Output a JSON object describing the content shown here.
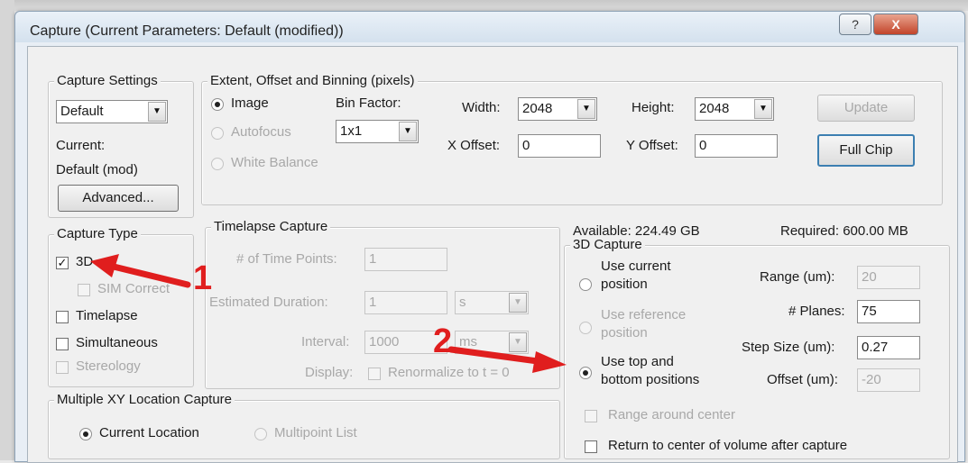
{
  "window": {
    "title": "Capture (Current Parameters: Default (modified))",
    "help_label": "?",
    "close_label": "X"
  },
  "capture_settings": {
    "group": "Capture Settings",
    "preset": "Default",
    "current_label": "Current:",
    "current_value": "Default (mod)",
    "advanced_button": "Advanced..."
  },
  "extent": {
    "group": "Extent, Offset and Binning (pixels)",
    "radio_image": "Image",
    "radio_autofocus": "Autofocus",
    "radio_white_balance": "White Balance",
    "bin_factor_label": "Bin Factor:",
    "bin_factor_value": "1x1",
    "width_label": "Width:",
    "width_value": "2048",
    "height_label": "Height:",
    "height_value": "2048",
    "x_offset_label": "X Offset:",
    "x_offset_value": "0",
    "y_offset_label": "Y Offset:",
    "y_offset_value": "0",
    "update_button": "Update",
    "full_chip_button": "Full Chip"
  },
  "capture_type": {
    "group": "Capture Type",
    "items": [
      {
        "label": "3D",
        "checked": true,
        "enabled": true
      },
      {
        "label": "SIM Correct",
        "checked": false,
        "enabled": false
      },
      {
        "label": "Timelapse",
        "checked": false,
        "enabled": true
      },
      {
        "label": "Simultaneous",
        "checked": false,
        "enabled": true
      },
      {
        "label": "Stereology",
        "checked": false,
        "enabled": false
      }
    ]
  },
  "timelapse": {
    "group": "Timelapse Capture",
    "time_points_label": "# of Time Points:",
    "time_points_value": "1",
    "est_duration_label": "Estimated Duration:",
    "est_duration_value": "1",
    "est_duration_unit": "s",
    "interval_label": "Interval:",
    "interval_value": "1000",
    "interval_unit": "ms",
    "display_label": "Display:",
    "renormalize_label": "Renormalize to t = 0"
  },
  "storage": {
    "available": "Available: 224.49 GB",
    "required": "Required: 600.00 MB"
  },
  "capture3d": {
    "group": "3D Capture",
    "opt_current": "Use current position",
    "opt_current_l1": "Use current",
    "opt_current_l2": "position",
    "opt_reference_l1": "Use reference",
    "opt_reference_l2": "position",
    "opt_topbottom_l1": "Use top and",
    "opt_topbottom_l2": "bottom positions",
    "range_label": "Range (um):",
    "range_value": "20",
    "planes_label": "# Planes:",
    "planes_value": "75",
    "step_label": "Step Size (um):",
    "step_value": "0.27",
    "offset_label": "Offset (um):",
    "offset_value": "-20",
    "range_around_center": "Range around center",
    "return_to_center": "Return to center of volume after capture"
  },
  "multi_xy": {
    "group": "Multiple XY Location Capture",
    "current_location": "Current Location",
    "multipoint_list": "Multipoint List"
  },
  "annotations": {
    "arrow1_number": "1",
    "arrow2_number": "2",
    "color": "#e01e1e"
  }
}
